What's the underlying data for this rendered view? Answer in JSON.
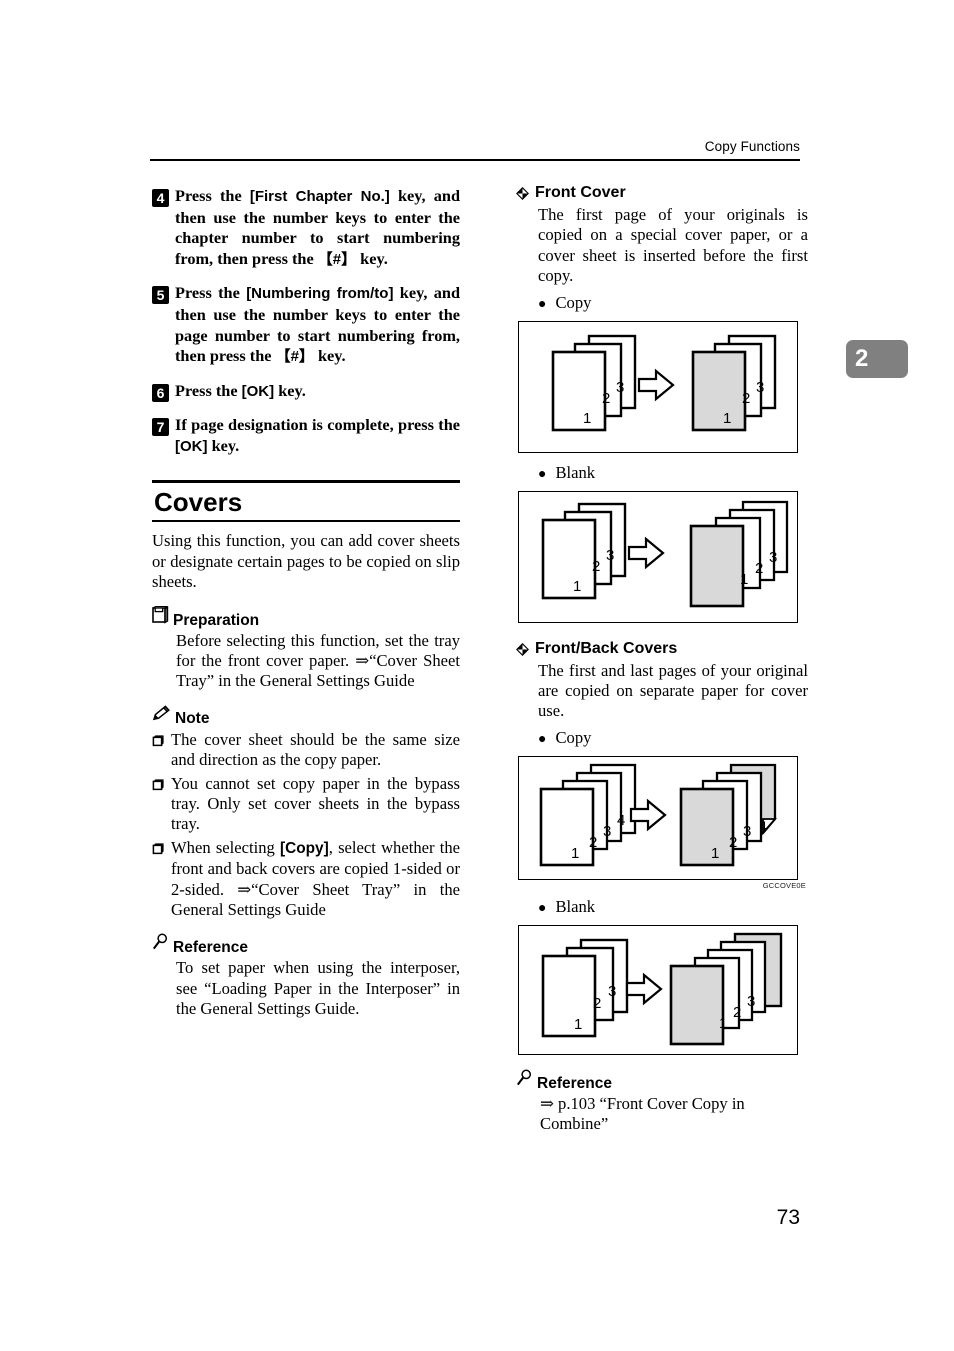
{
  "header": {
    "running_title": "Copy Functions"
  },
  "chapter_tab": {
    "number": "2",
    "bg_color": "#808080",
    "text_color": "#ffffff"
  },
  "page_number": "73",
  "left_column": {
    "steps": [
      {
        "number": "4",
        "text_parts": [
          {
            "t": "Press the ",
            "style": "serif"
          },
          {
            "t": "[First Chapter No.]",
            "style": "sans"
          },
          {
            "t": " key, and then use the number keys to enter the chapter number to start numbering from, then press the ",
            "style": "serif"
          },
          {
            "t": "【#】",
            "style": "sans"
          },
          {
            "t": " key.",
            "style": "serif"
          }
        ]
      },
      {
        "number": "5",
        "text_parts": [
          {
            "t": "Press the ",
            "style": "serif"
          },
          {
            "t": "[Numbering from/to]",
            "style": "sans"
          },
          {
            "t": " key, and then use the number keys to enter the page number to start numbering from, then press the ",
            "style": "serif"
          },
          {
            "t": "【#】",
            "style": "sans"
          },
          {
            "t": " key.",
            "style": "serif"
          }
        ]
      },
      {
        "number": "6",
        "text_parts": [
          {
            "t": "Press the ",
            "style": "serif"
          },
          {
            "t": "[OK]",
            "style": "sans"
          },
          {
            "t": " key.",
            "style": "serif"
          }
        ]
      },
      {
        "number": "7",
        "text_parts": [
          {
            "t": "If page designation is complete, press the ",
            "style": "serif"
          },
          {
            "t": "[OK]",
            "style": "sans"
          },
          {
            "t": " key.",
            "style": "serif"
          }
        ]
      }
    ],
    "section": {
      "title": "Covers",
      "intro": "Using this function, you can add cover sheets or designate certain pages to be copied on slip sheets."
    },
    "preparation": {
      "icon": "book-icon",
      "label": "Preparation",
      "text": "Before selecting this function, set the tray for the front cover paper. ⇒“Cover Sheet Tray” in the General Settings Guide"
    },
    "note": {
      "icon": "pencil-icon",
      "label": "Note",
      "items": [
        {
          "parts": [
            {
              "t": "The cover sheet should be the same size and direction as the copy paper.",
              "style": "serif"
            }
          ]
        },
        {
          "parts": [
            {
              "t": "You cannot set copy paper in the bypass tray. Only set cover sheets in the bypass tray.",
              "style": "serif"
            }
          ]
        },
        {
          "parts": [
            {
              "t": "When selecting ",
              "style": "serif"
            },
            {
              "t": "[Copy]",
              "style": "sans"
            },
            {
              "t": ", select whether the front and back covers are copied 1-sided or 2-sided. ⇒“Cover Sheet Tray” in the General Settings Guide",
              "style": "serif"
            }
          ]
        }
      ]
    },
    "reference": {
      "icon": "magnifier-icon",
      "label": "Reference",
      "text": "To set paper when using the interposer, see “Loading Paper in the Interposer” in the General Settings Guide."
    }
  },
  "right_column": {
    "features": [
      {
        "bullet_icon": "diamond-icon",
        "title": "Front Cover",
        "description": "The first page of your originals is copied on a special cover paper, or a cover sheet is inserted before the first copy.",
        "variants": [
          {
            "label": "Copy",
            "figure_id": "fig-front-cover-copy",
            "caption": ""
          },
          {
            "label": "Blank",
            "figure_id": "fig-front-cover-blank",
            "caption": ""
          }
        ]
      },
      {
        "bullet_icon": "diamond-icon",
        "title": "Front/Back Covers",
        "description": "The first and last pages of your original are copied on separate paper for cover use.",
        "variants": [
          {
            "label": "Copy",
            "figure_id": "fig-fb-covers-copy",
            "caption": "GCCOVE0E"
          },
          {
            "label": "Blank",
            "figure_id": "fig-fb-covers-blank",
            "caption": ""
          }
        ]
      }
    ],
    "reference": {
      "icon": "magnifier-icon",
      "label": "Reference",
      "text": "⇒ p.103 “Front Cover Copy in Combine”"
    }
  },
  "figures": {
    "fig-front-cover-copy": {
      "type": "process-diagram",
      "description": "Three original sheets numbered 1,2,3 become three sheets where sheet 1 is a shaded cover sheet",
      "left_stack": {
        "count": 3,
        "labels": [
          "1",
          "2",
          "3"
        ],
        "shaded_indices": []
      },
      "right_stack": {
        "count": 3,
        "labels": [
          "1",
          "2",
          "3"
        ],
        "shaded_indices": [
          0
        ]
      },
      "arrow": "right-arrow"
    },
    "fig-front-cover-blank": {
      "type": "process-diagram",
      "description": "Three original sheets numbered 1,2,3 become four sheets where a shaded blank cover is inserted in front",
      "left_stack": {
        "count": 3,
        "labels": [
          "1",
          "2",
          "3"
        ],
        "shaded_indices": []
      },
      "right_stack": {
        "count": 4,
        "labels": [
          "",
          "1",
          "2",
          "3"
        ],
        "shaded_indices": [
          0
        ]
      },
      "arrow": "right-arrow"
    },
    "fig-fb-covers-copy": {
      "type": "process-diagram",
      "description": "Four original sheets numbered 1,2,3,4 become four sheets where sheets 1 and 4 are shaded cover sheets",
      "left_stack": {
        "count": 4,
        "labels": [
          "1",
          "2",
          "3",
          "4"
        ],
        "shaded_indices": []
      },
      "right_stack": {
        "count": 4,
        "labels": [
          "1",
          "2",
          "3",
          "4"
        ],
        "shaded_indices": [
          0,
          3
        ]
      },
      "arrow": "right-arrow"
    },
    "fig-fb-covers-blank": {
      "type": "process-diagram",
      "description": "Three original sheets numbered 1,2,3 become five sheets with shaded blank covers front and back",
      "left_stack": {
        "count": 3,
        "labels": [
          "1",
          "2",
          "3"
        ],
        "shaded_indices": []
      },
      "right_stack": {
        "count": 5,
        "labels": [
          "",
          "1",
          "2",
          "3",
          ""
        ],
        "shaded_indices": [
          0,
          4
        ]
      },
      "arrow": "right-arrow"
    },
    "shade_color": "#d9d9d9"
  }
}
